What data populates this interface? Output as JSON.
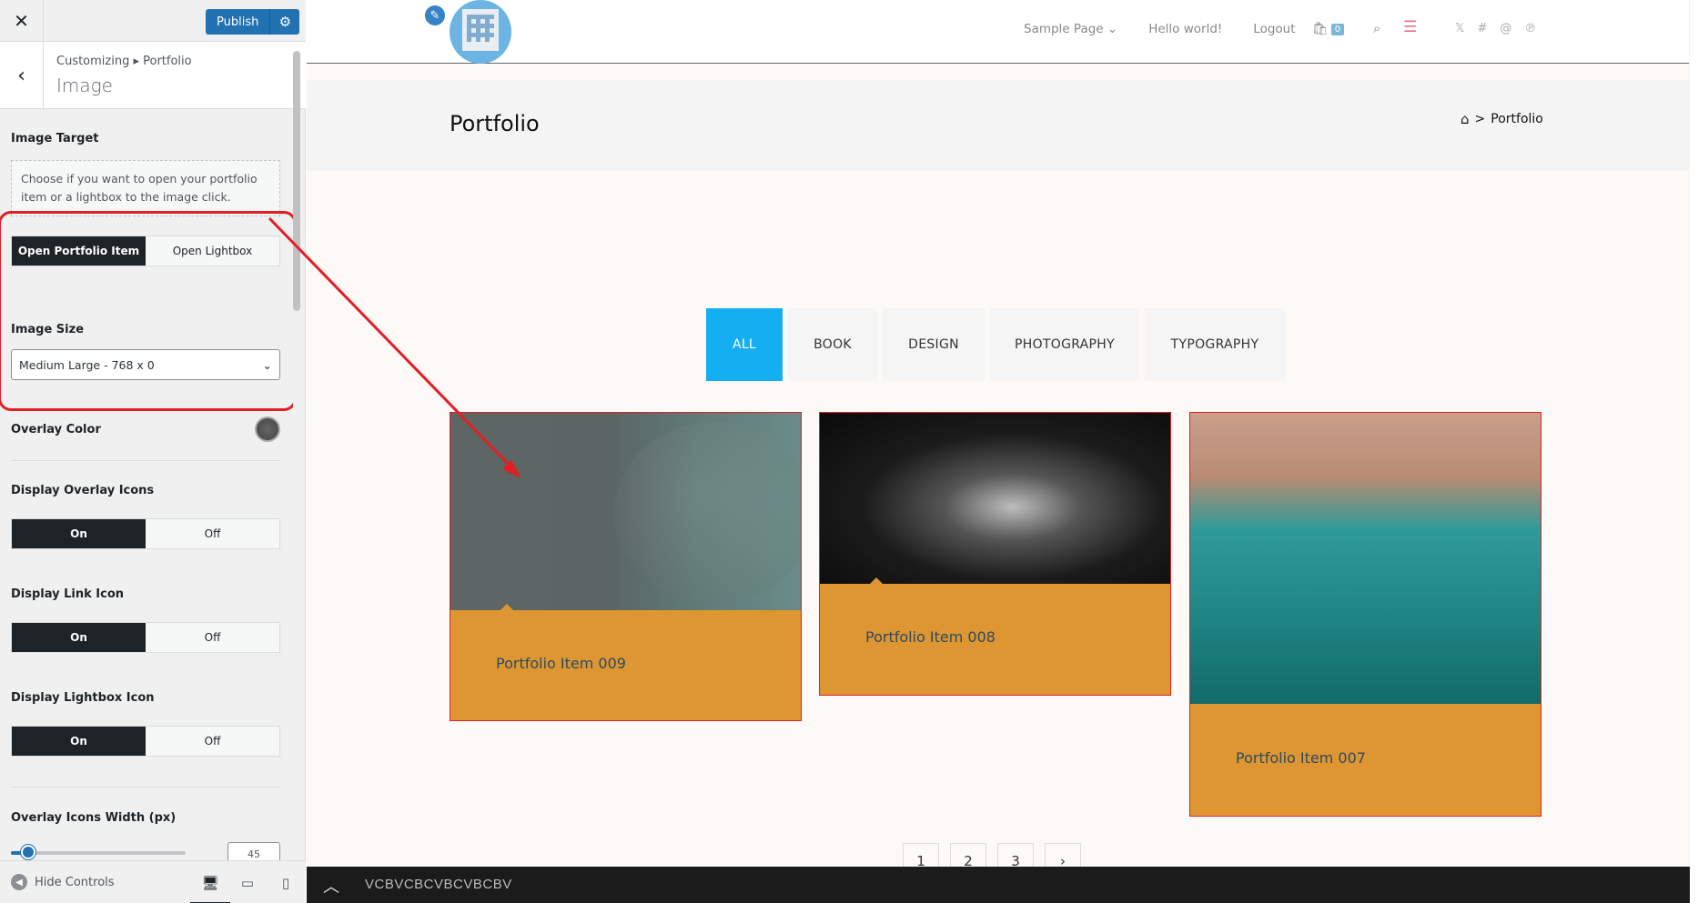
{
  "customizer": {
    "close_icon": "close-icon",
    "publish_label": "Publish",
    "breadcrumb": "Customizing ▸ Portfolio",
    "section_title": "Image",
    "image_target": {
      "label": "Image Target",
      "description": "Choose if you want to open your portfolio item or a lightbox to the image click.",
      "options": [
        "Open Portfolio Item",
        "Open Lightbox"
      ],
      "selected": "Open Portfolio Item"
    },
    "image_size": {
      "label": "Image Size",
      "value": "Medium Large - 768 x 0"
    },
    "overlay_color": {
      "label": "Overlay Color",
      "value": "#555555"
    },
    "display_overlay_icons": {
      "label": "Display Overlay Icons",
      "on": "On",
      "off": "Off",
      "selected": "On"
    },
    "display_link_icon": {
      "label": "Display Link Icon",
      "on": "On",
      "off": "Off",
      "selected": "On"
    },
    "display_lightbox_icon": {
      "label": "Display Lightbox Icon",
      "on": "On",
      "off": "Off",
      "selected": "On"
    },
    "overlay_icons_width": {
      "label": "Overlay Icons Width (px)",
      "value": "45"
    },
    "footer": {
      "hide_controls": "Hide Controls"
    }
  },
  "site": {
    "nav": [
      "Sample Page",
      "Hello world!",
      "Logout"
    ],
    "cart_count": "0",
    "page_title": "Portfolio",
    "breadcrumb_current": "Portfolio",
    "filters": [
      "ALL",
      "BOOK",
      "DESIGN",
      "PHOTOGRAPHY",
      "TYPOGRAPHY"
    ],
    "active_filter": "ALL",
    "items": [
      {
        "title": "Portfolio Item 009"
      },
      {
        "title": "Portfolio Item 008"
      },
      {
        "title": "Portfolio Item 007"
      }
    ],
    "pagination": [
      "1",
      "2",
      "3"
    ],
    "bottom_bar_text": "VCBVCBCVBCVBCBV"
  },
  "colors": {
    "accent": "#13aff0",
    "card_bg": "#de9632",
    "publish": "#2271b1",
    "annotation": "#e31e24"
  }
}
